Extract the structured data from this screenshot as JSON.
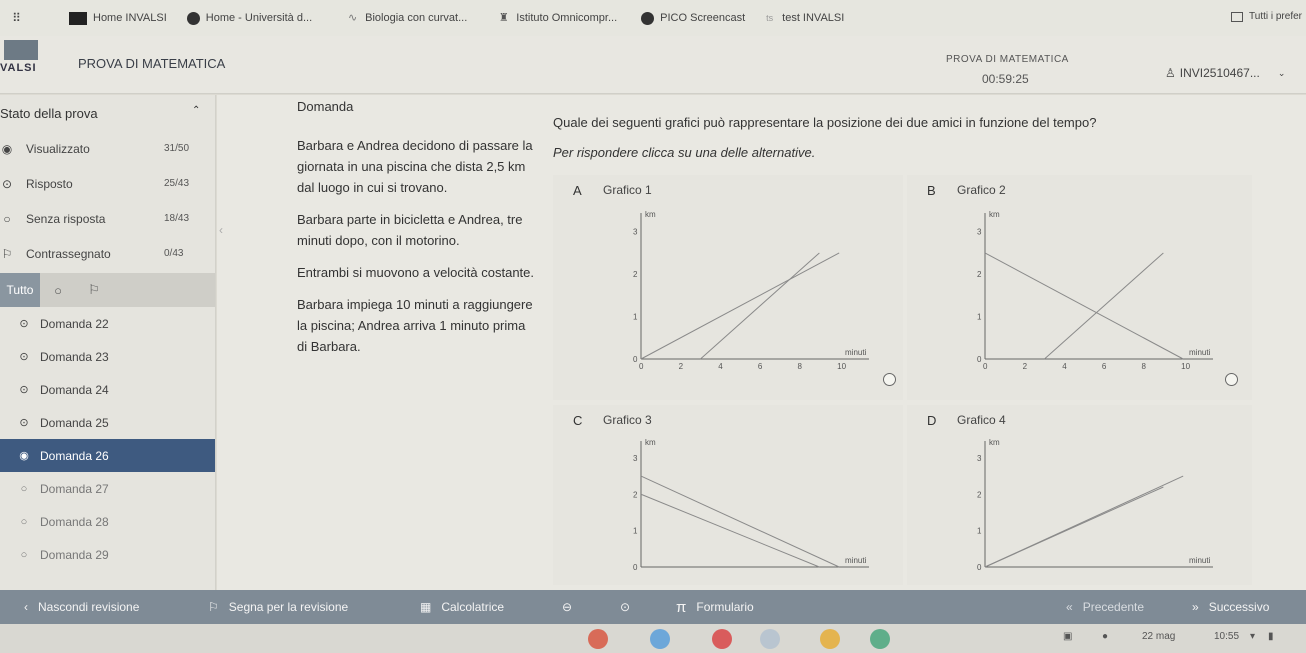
{
  "bookmarks": [
    {
      "label": "Home INVALSI",
      "icon": "bookmark-icon"
    },
    {
      "label": "Home - Università d...",
      "icon": "globe-icon"
    },
    {
      "label": "Biologia con curvat...",
      "icon": "leaf-icon"
    },
    {
      "label": "Istituto Omnicompr...",
      "icon": "school-icon"
    },
    {
      "label": "PICO Screencast",
      "icon": "record-icon"
    },
    {
      "label": "test INVALSI",
      "icon": "tag-icon"
    }
  ],
  "bookmarks_right": "Tutti i prefer",
  "header": {
    "logo": "VALSI",
    "title": "PROVA DI MATEMATICA",
    "subtitle": "PROVA DI MATEMATICA",
    "timer": "00:59:25",
    "user": "INVI2510467..."
  },
  "sidebar": {
    "title": "Stato della prova",
    "stats": [
      {
        "label": "Visualizzato",
        "count": "31/50",
        "icon": "eye-icon"
      },
      {
        "label": "Risposto",
        "count": "25/43",
        "icon": "answered-icon"
      },
      {
        "label": "Senza risposta",
        "count": "18/43",
        "icon": "unanswered-icon"
      },
      {
        "label": "Contrassegnato",
        "count": "0/43",
        "icon": "flag-icon"
      }
    ],
    "filter_all": "Tutto",
    "questions": [
      {
        "label": "Domanda 22",
        "state": "answered"
      },
      {
        "label": "Domanda 23",
        "state": "answered"
      },
      {
        "label": "Domanda 24",
        "state": "answered"
      },
      {
        "label": "Domanda 25",
        "state": "answered"
      },
      {
        "label": "Domanda 26",
        "state": "active"
      },
      {
        "label": "Domanda 27",
        "state": "empty"
      },
      {
        "label": "Domanda 28",
        "state": "empty"
      },
      {
        "label": "Domanda 29",
        "state": "empty"
      }
    ]
  },
  "question": {
    "header": "Domanda",
    "stem": [
      "Barbara e Andrea decidono di passare la giornata in una piscina che dista 2,5 km dal luogo in cui si trovano.",
      "Barbara parte in bicicletta e Andrea, tre minuti dopo, con il motorino.",
      "Entrambi si muovono a velocità costante.",
      "Barbara impiega 10 minuti a raggiungere la piscina; Andrea arriva 1 minuto prima di Barbara."
    ],
    "title": "Quale dei seguenti grafici può rappresentare la posizione dei due amici in funzione del tempo?",
    "instruction": "Per rispondere clicca su una delle alternative.",
    "options": [
      {
        "letter": "A",
        "label": "Grafico 1"
      },
      {
        "letter": "B",
        "label": "Grafico 2"
      },
      {
        "letter": "C",
        "label": "Grafico 3"
      },
      {
        "letter": "D",
        "label": "Grafico 4"
      }
    ]
  },
  "chart_data": [
    {
      "type": "line",
      "title": "Grafico 1",
      "xlabel": "minuti",
      "ylabel": "km",
      "xticks": [
        "0",
        "2",
        "4",
        "6",
        "8",
        "10"
      ],
      "yticks": [
        "0",
        "1",
        "2",
        "3"
      ],
      "xlim": [
        0,
        11
      ],
      "ylim": [
        0,
        3.3
      ],
      "series": [
        {
          "x": [
            0,
            10
          ],
          "y": [
            0,
            2.5
          ]
        },
        {
          "x": [
            3,
            9
          ],
          "y": [
            0,
            2.5
          ]
        }
      ]
    },
    {
      "type": "line",
      "title": "Grafico 2",
      "xlabel": "minuti",
      "ylabel": "km",
      "xticks": [
        "0",
        "2",
        "4",
        "6",
        "8",
        "10"
      ],
      "yticks": [
        "0",
        "1",
        "2",
        "3"
      ],
      "xlim": [
        0,
        11
      ],
      "ylim": [
        0,
        3.3
      ],
      "series": [
        {
          "x": [
            0,
            10
          ],
          "y": [
            2.5,
            0
          ]
        },
        {
          "x": [
            3,
            9
          ],
          "y": [
            0,
            2.5
          ]
        }
      ]
    },
    {
      "type": "line",
      "title": "Grafico 3",
      "xlabel": "minuti",
      "ylabel": "km",
      "xticks": [],
      "yticks": [
        "0",
        "1",
        "2",
        "3"
      ],
      "xlim": [
        0,
        11
      ],
      "ylim": [
        0,
        3.3
      ],
      "series": [
        {
          "x": [
            0,
            10
          ],
          "y": [
            2.5,
            0
          ]
        },
        {
          "x": [
            0,
            9
          ],
          "y": [
            2.0,
            0
          ]
        }
      ]
    },
    {
      "type": "line",
      "title": "Grafico 4",
      "xlabel": "minuti",
      "ylabel": "km",
      "xticks": [],
      "yticks": [
        "0",
        "1",
        "2",
        "3"
      ],
      "xlim": [
        0,
        11
      ],
      "ylim": [
        0,
        3.3
      ],
      "series": [
        {
          "x": [
            0,
            10
          ],
          "y": [
            0,
            2.5
          ]
        },
        {
          "x": [
            0,
            9
          ],
          "y": [
            0,
            2.2
          ]
        }
      ]
    }
  ],
  "toolbar": {
    "hide_review": "Nascondi revisione",
    "mark_review": "Segna per la revisione",
    "calculator": "Calcolatrice",
    "formulary": "Formulario",
    "previous": "Precedente",
    "next": "Successivo"
  },
  "taskbar": {
    "date": "22 mag",
    "time": "10:55"
  }
}
